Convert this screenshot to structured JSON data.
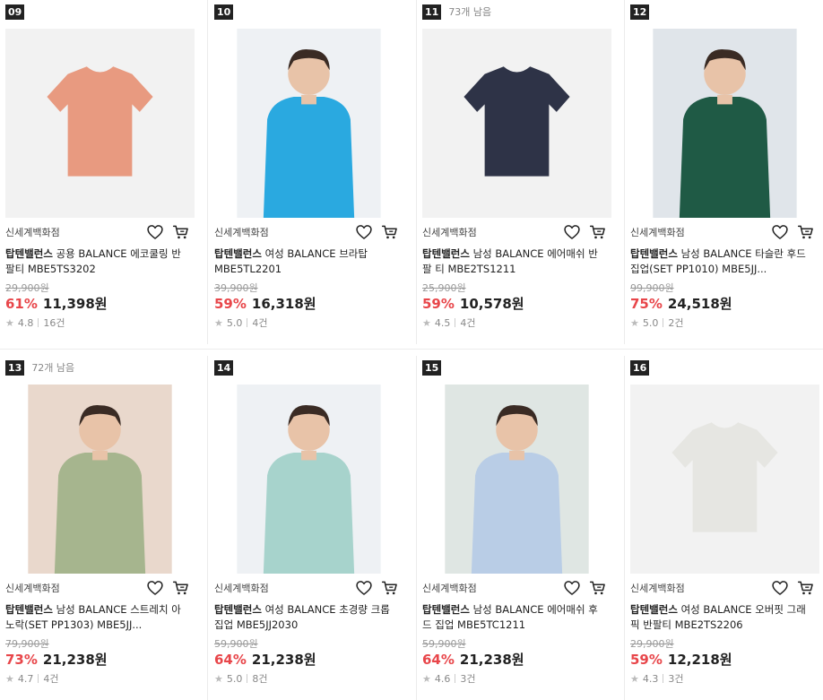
{
  "products": [
    {
      "rank": "09",
      "stock": "",
      "store": "신세계백화점",
      "brand": "탑텐밸런스",
      "name": "공용 BALANCE 에코쿨링 반팔티 MBE5TS3202",
      "original_price": "29,900원",
      "discount": "61%",
      "price": "11,398원",
      "rating": "4.8",
      "reviews": "16건",
      "color": "#e89a80"
    },
    {
      "rank": "10",
      "stock": "",
      "store": "신세계백화점",
      "brand": "탑텐밸런스",
      "name": "여성 BALANCE 브라탑 MBE5TL2201",
      "original_price": "39,900원",
      "discount": "59%",
      "price": "16,318원",
      "rating": "5.0",
      "reviews": "4건",
      "color": "#2aa9e0"
    },
    {
      "rank": "11",
      "stock": "73개 남음",
      "store": "신세계백화점",
      "brand": "탑텐밸런스",
      "name": "남성 BALANCE 에어매쉬 반팔 티 MBE2TS1211",
      "original_price": "25,900원",
      "discount": "59%",
      "price": "10,578원",
      "rating": "4.5",
      "reviews": "4건",
      "color": "#2e3347"
    },
    {
      "rank": "12",
      "stock": "",
      "store": "신세계백화점",
      "brand": "탑텐밸런스",
      "name": "남성 BALANCE 타슬란 후드 집업(SET PP1010) MBE5JJ...",
      "original_price": "99,900원",
      "discount": "75%",
      "price": "24,518원",
      "rating": "5.0",
      "reviews": "2건",
      "color": "#1f5a45"
    },
    {
      "rank": "13",
      "stock": "72개 남음",
      "store": "신세계백화점",
      "brand": "탑텐밸런스",
      "name": "남성 BALANCE 스트레치 아노락(SET PP1303) MBE5JJ...",
      "original_price": "79,900원",
      "discount": "73%",
      "price": "21,238원",
      "rating": "4.7",
      "reviews": "4건",
      "color": "#a6b58e"
    },
    {
      "rank": "14",
      "stock": "",
      "store": "신세계백화점",
      "brand": "탑텐밸런스",
      "name": "여성 BALANCE 초경량 크롭 집업 MBE5JJ2030",
      "original_price": "59,900원",
      "discount": "64%",
      "price": "21,238원",
      "rating": "5.0",
      "reviews": "8건",
      "color": "#a7d3cc"
    },
    {
      "rank": "15",
      "stock": "",
      "store": "신세계백화점",
      "brand": "탑텐밸런스",
      "name": "남성 BALANCE 에어매쉬 후드 집업 MBE5TC1211",
      "original_price": "59,900원",
      "discount": "64%",
      "price": "21,238원",
      "rating": "4.6",
      "reviews": "3건",
      "color": "#b9cde6"
    },
    {
      "rank": "16",
      "stock": "",
      "store": "신세계백화점",
      "brand": "탑텐밸런스",
      "name": "여성 BALANCE 오버핏 그래픽 반팔티 MBE2TS2206",
      "original_price": "29,900원",
      "discount": "59%",
      "price": "12,218원",
      "rating": "4.3",
      "reviews": "3건",
      "color": "#e6e6e2"
    }
  ],
  "icons": {
    "wishlist": "heart-icon",
    "cart": "cart-icon",
    "rating": "star-icon"
  },
  "colors": {
    "discount": "#e8464a",
    "rank_badge": "#222222"
  }
}
